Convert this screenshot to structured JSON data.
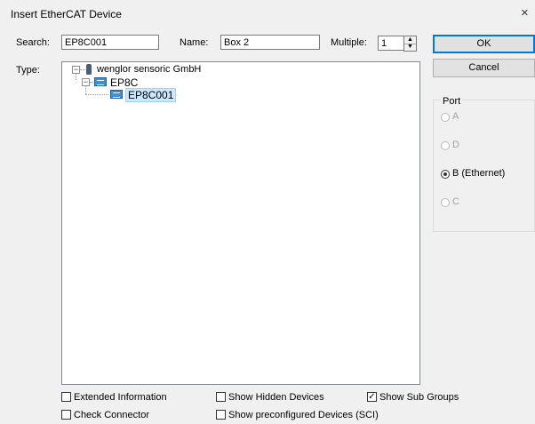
{
  "dialog": {
    "title": "Insert EtherCAT Device",
    "close_glyph": "×"
  },
  "search": {
    "label": "Search:",
    "value": "EP8C001"
  },
  "name": {
    "label": "Name:",
    "value": "Box 2"
  },
  "multiple": {
    "label": "Multiple:",
    "value": "1"
  },
  "buttons": {
    "ok": "OK",
    "cancel": "Cancel"
  },
  "type": {
    "label": "Type:"
  },
  "tree": {
    "root": {
      "label": "wenglor sensoric GmbH",
      "icon": "vendor-icon",
      "expander": "−"
    },
    "group": {
      "label": "EP8C",
      "icon": "device-group-icon",
      "expander": "−"
    },
    "device": {
      "label": "EP8C001",
      "icon": "device-icon"
    }
  },
  "port": {
    "title": "Port",
    "options": [
      {
        "label": "A",
        "selected": false,
        "enabled": false
      },
      {
        "label": "D",
        "selected": false,
        "enabled": false
      },
      {
        "label": "B (Ethernet)",
        "selected": true,
        "enabled": true
      },
      {
        "label": "C",
        "selected": false,
        "enabled": false
      }
    ]
  },
  "checkboxes": {
    "extended_info": {
      "label": "Extended Information",
      "checked": false
    },
    "hidden_devices": {
      "label": "Show Hidden Devices",
      "checked": false
    },
    "sub_groups": {
      "label": "Show Sub Groups",
      "checked": true
    },
    "check_connector": {
      "label": "Check Connector",
      "checked": false
    },
    "preconfigured": {
      "label": "Show preconfigured Devices (SCI)",
      "checked": false
    }
  },
  "glyphs": {
    "check": "✓",
    "spin_up": "▲",
    "spin_down": "▼"
  }
}
